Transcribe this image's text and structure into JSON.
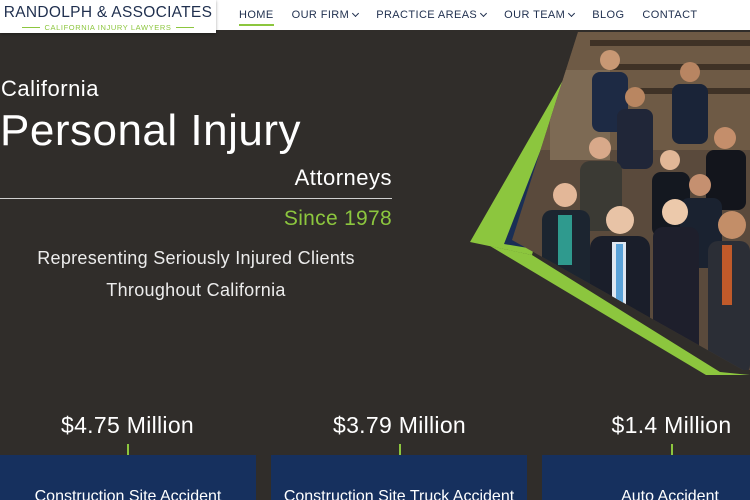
{
  "brand": {
    "name": "RANDOLPH & ASSOCIATES",
    "tagline": "CALIFORNIA INJURY LAWYERS"
  },
  "nav": {
    "items": [
      {
        "label": "HOME",
        "active": true,
        "has_dropdown": false
      },
      {
        "label": "OUR FIRM",
        "active": false,
        "has_dropdown": true
      },
      {
        "label": "PRACTICE AREAS",
        "active": false,
        "has_dropdown": true
      },
      {
        "label": "OUR TEAM",
        "active": false,
        "has_dropdown": true
      },
      {
        "label": "BLOG",
        "active": false,
        "has_dropdown": false
      },
      {
        "label": "CONTACT",
        "active": false,
        "has_dropdown": false
      }
    ]
  },
  "hero": {
    "line1": "California",
    "line2": "Personal Injury",
    "line3": "Attorneys",
    "since": "Since 1978",
    "sub1": "Representing Seriously Injured Clients",
    "sub2": "Throughout California"
  },
  "results": [
    {
      "amount": "$4.75 Million",
      "case": "Construction Site Accident"
    },
    {
      "amount": "$3.79 Million",
      "case": "Construction Site Truck Accident"
    },
    {
      "amount": "$1.4 Million",
      "case": "Auto Accident"
    }
  ],
  "colors": {
    "background": "#302d2a",
    "accent_green": "#8cc63e",
    "navy": "#1f2f4e",
    "card_navy": "#16305e"
  }
}
